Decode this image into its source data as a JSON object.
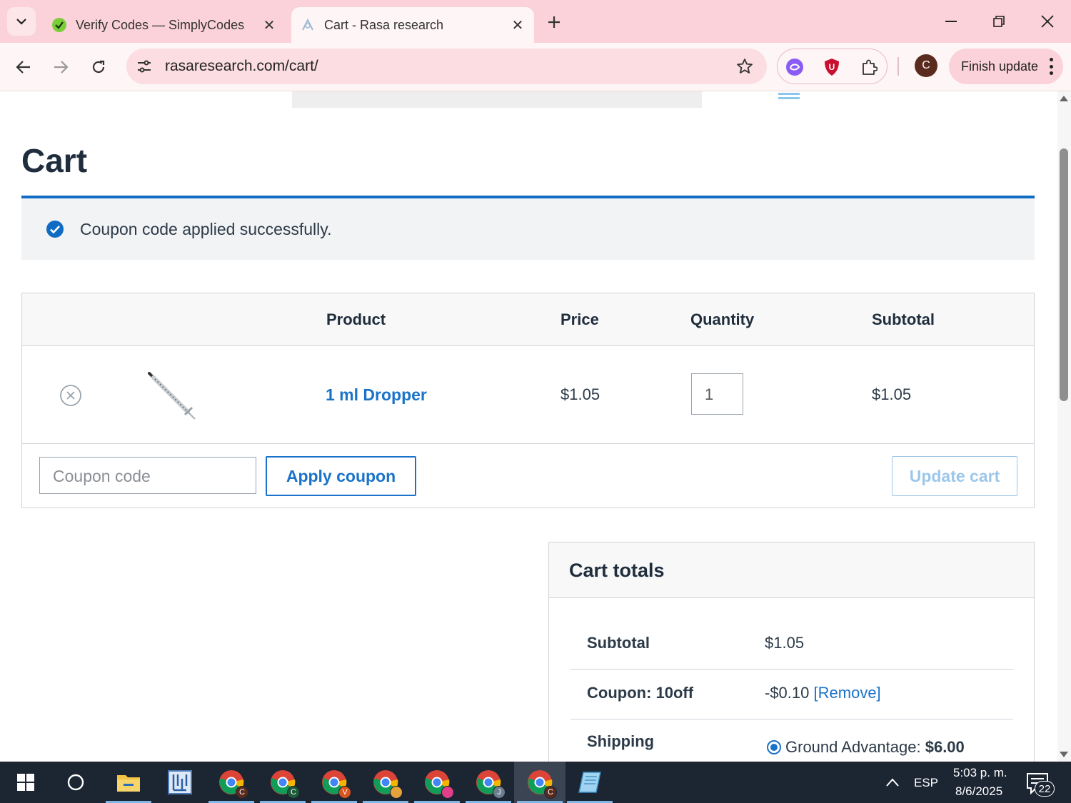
{
  "browser": {
    "tabs": [
      {
        "title": "Verify Codes — SimplyCodes",
        "favicon": "simplycodes-icon",
        "active": false
      },
      {
        "title": "Cart - Rasa research",
        "favicon": "rasa-icon",
        "active": true
      }
    ],
    "url": "rasaresearch.com/cart/",
    "profile_initial": "C",
    "finish_update_label": "Finish update"
  },
  "page": {
    "title": "Cart",
    "notice": "Coupon code applied successfully.",
    "table": {
      "headers": {
        "product": "Product",
        "price": "Price",
        "quantity": "Quantity",
        "subtotal": "Subtotal"
      },
      "rows": [
        {
          "product": "1 ml Dropper",
          "price": "$1.05",
          "quantity": "1",
          "subtotal": "$1.05"
        }
      ]
    },
    "coupon_placeholder": "Coupon code",
    "apply_coupon_label": "Apply coupon",
    "update_cart_label": "Update cart",
    "totals": {
      "title": "Cart totals",
      "subtotal_label": "Subtotal",
      "subtotal_value": "$1.05",
      "coupon_label": "Coupon: 10off",
      "coupon_value": "-$0.10",
      "coupon_remove": "[Remove]",
      "shipping_label": "Shipping",
      "shipping_method": "Ground Advantage:",
      "shipping_price": "$6.00"
    }
  },
  "taskbar": {
    "chrome_badges": [
      "C",
      "C",
      "V",
      "",
      "",
      "J",
      "C"
    ],
    "language": "ESP",
    "time": "5:03 p. m.",
    "date": "8/6/2025",
    "notification_count": "22"
  },
  "colors": {
    "accent": "#1a73c8",
    "notice_border": "#0f6cc2",
    "tabbar": "#fbd2d9",
    "taskbar": "#1c2532"
  }
}
